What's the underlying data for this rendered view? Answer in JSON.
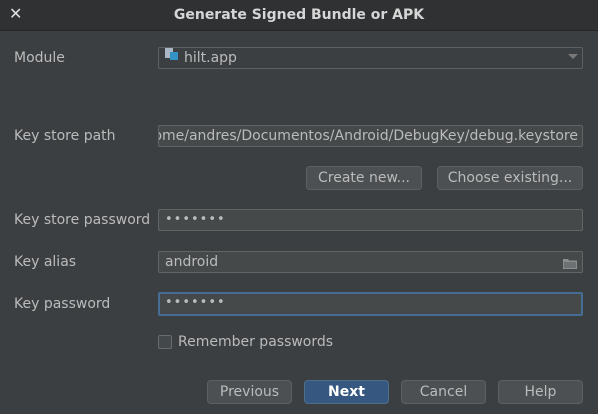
{
  "window": {
    "title": "Generate Signed Bundle or APK"
  },
  "module": {
    "label": "Module",
    "value": "hilt.app"
  },
  "key_store_path": {
    "label": "Key store path",
    "value": "/home/andres/Documentos/Android/DebugKey/debug.keystore"
  },
  "keystore_buttons": {
    "create_new": "Create new...",
    "choose_existing": "Choose existing..."
  },
  "key_store_password": {
    "label": "Key store password",
    "masked_value": "•••••••"
  },
  "key_alias": {
    "label": "Key alias",
    "value": "android"
  },
  "key_password": {
    "label": "Key password",
    "masked_value": "•••••••"
  },
  "remember": {
    "label": "Remember passwords",
    "checked": false
  },
  "footer": {
    "previous": "Previous",
    "next": "Next",
    "cancel": "Cancel",
    "help": "Help"
  },
  "colors": {
    "background": "#3c3f41",
    "field_bg": "#45494a",
    "focus_border": "#466d94",
    "default_button": "#365880"
  }
}
